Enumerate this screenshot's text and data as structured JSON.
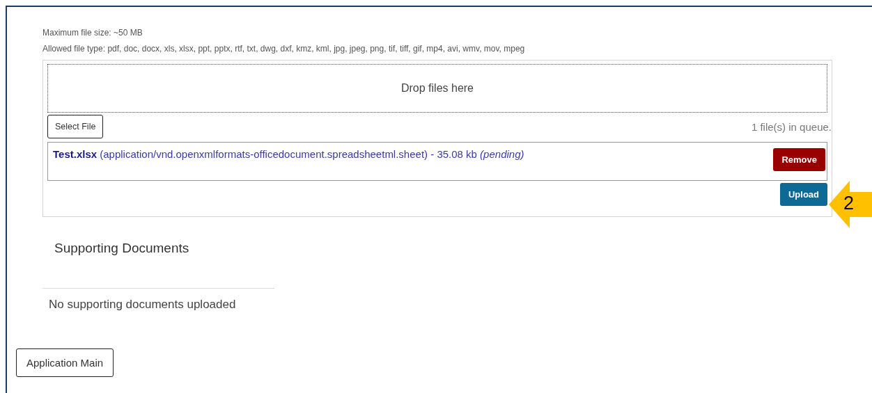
{
  "upload_panel": {
    "max_size": "Maximum file size: ~50 MB",
    "allowed_types": "Allowed file type: pdf, doc, docx, xls, xlsx, ppt, pptx, rtf, txt, dwg, dxf, kmz, kml, jpg, jpeg, png, tif, tiff, gif, mp4, avi, wmv, mov, mpeg",
    "drop_zone": "Drop files here",
    "select_button": "Select File",
    "queue_count": "1 file(s) in queue.",
    "queue": [
      {
        "text": "**Test.xlsx** (application/vnd.openxmlformats-officedocument.spreadsheetml.sheet) - 35.08 kb *(pending)*",
        "remove_button": "Remove"
      }
    ],
    "upload_button": "Upload"
  },
  "callout": {
    "label": "2"
  },
  "supporting_documents": {
    "title": "Supporting Documents",
    "empty_message": "No supporting documents uploaded"
  },
  "nav_button": "Application Main"
}
